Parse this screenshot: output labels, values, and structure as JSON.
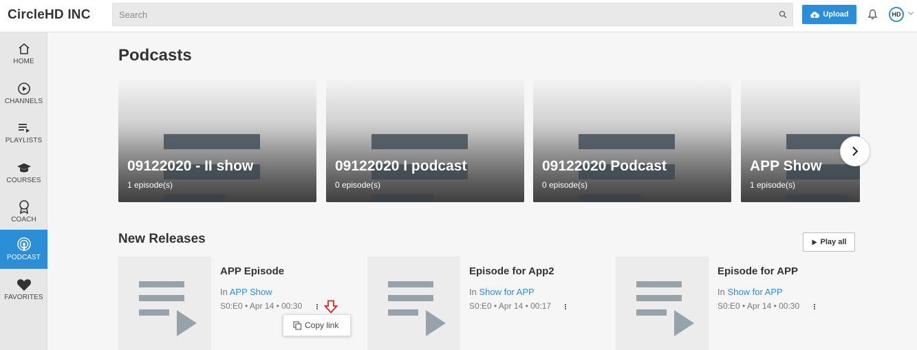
{
  "header": {
    "brand": "CircleHD INC",
    "search_placeholder": "Search",
    "upload_label": "Upload",
    "avatar_initials": "HD"
  },
  "sidebar": {
    "items": [
      {
        "label": "HOME",
        "icon": "home-icon"
      },
      {
        "label": "CHANNELS",
        "icon": "play-circle-icon"
      },
      {
        "label": "PLAYLISTS",
        "icon": "playlist-icon"
      },
      {
        "label": "COURSES",
        "icon": "graduation-cap-icon"
      },
      {
        "label": "COACH",
        "icon": "award-icon"
      },
      {
        "label": "PODCAST",
        "icon": "podcast-icon",
        "active": true
      },
      {
        "label": "FAVORITES",
        "icon": "heart-icon"
      }
    ]
  },
  "podcasts": {
    "heading": "Podcasts",
    "cards": [
      {
        "title": "09122020 - II show",
        "subtitle": "1 episode(s)"
      },
      {
        "title": "09122020 I podcast",
        "subtitle": "0 episode(s)"
      },
      {
        "title": "09122020 Podcast",
        "subtitle": "0 episode(s)"
      },
      {
        "title": "APP Show",
        "subtitle": "1 episode(s)"
      }
    ]
  },
  "new_releases": {
    "heading": "New Releases",
    "play_all_label": "Play all",
    "episodes": [
      {
        "title": "APP Episode",
        "in_prefix": "In",
        "show": "APP Show",
        "meta": "S0:E0 • Apr 14 • 00:30"
      },
      {
        "title": "Episode for App2",
        "in_prefix": "In",
        "show": "Show for APP",
        "meta": "S0:E0 • Apr 14 • 00:17"
      },
      {
        "title": "Episode for APP",
        "in_prefix": "In",
        "show": "Show for APP",
        "meta": "S0:E0 • Apr 14 • 00:30"
      }
    ]
  },
  "context_menu": {
    "copy_link_label": "Copy link"
  },
  "colors": {
    "accent": "#2c8ed6",
    "arrow": "#e02020"
  }
}
